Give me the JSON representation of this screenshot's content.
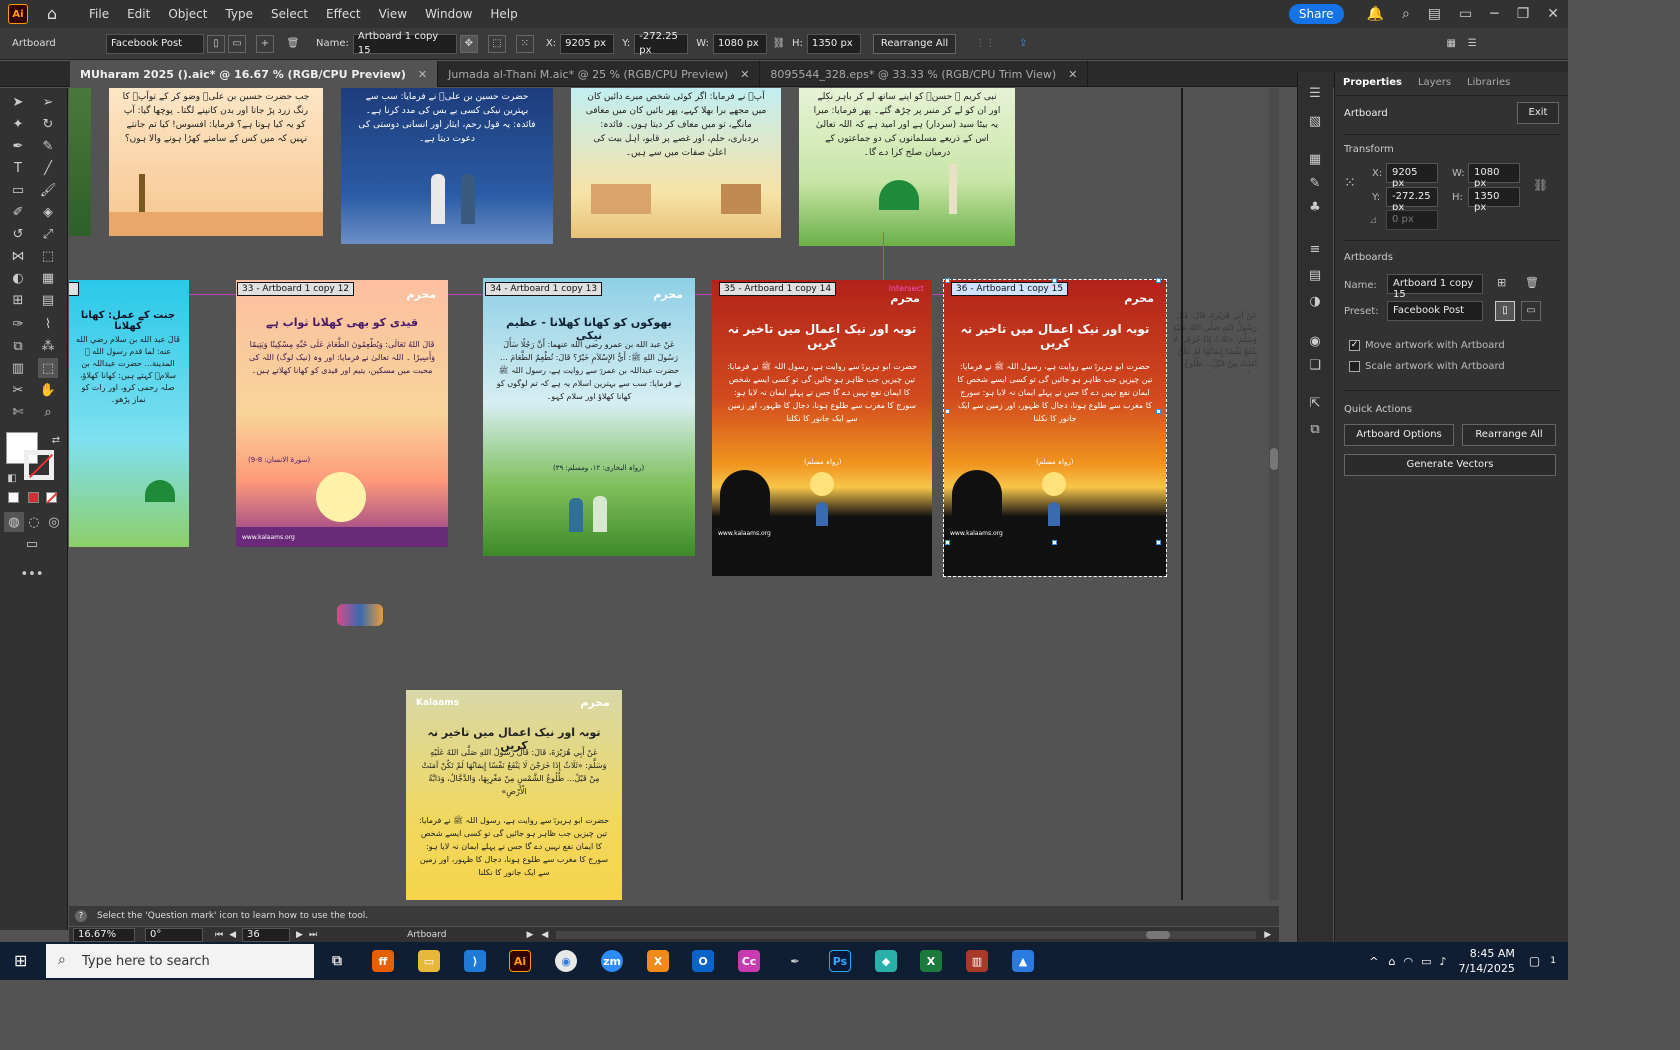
{
  "menubar": {
    "app_icon": "Ai",
    "items": [
      "File",
      "Edit",
      "Object",
      "Type",
      "Select",
      "Effect",
      "View",
      "Window",
      "Help"
    ],
    "share_label": "Share"
  },
  "controlbar": {
    "mode_label": "Artboard",
    "preset": "Facebook Post",
    "name_label": "Name:",
    "name_value": "Artboard 1 copy 15",
    "x_label": "X:",
    "x_value": "9205 px",
    "y_label": "Y:",
    "y_value": "-272.25 px",
    "w_label": "W:",
    "w_value": "1080 px",
    "h_label": "H:",
    "h_value": "1350 px",
    "rearrange_label": "Rearrange All"
  },
  "tabs": [
    {
      "label": "MUharam 2025 ().aic* @ 16.67 % (RGB/CPU Preview)",
      "active": true
    },
    {
      "label": "Jumada al-Thani M.aic* @ 25 % (RGB/CPU Preview)",
      "active": false
    },
    {
      "label": "8095544_328.eps* @ 33.33 % (RGB/CPU Trim View)",
      "active": false
    }
  ],
  "artboards": {
    "row1": [
      {
        "text": "جب حضرت حسین بن علیؓ وضو کر کے توآپؓ کا رنگ زرد پڑ جاتا اور بدن کانپنے لگتا۔ پوچھا گیا: آپ کو یہ کیا ہوتا ہے؟ فرمایا: افسوس! کیا تم جانتے نہیں کہ میں کس کے سامنے کھڑا ہونے والا ہوں؟"
      },
      {
        "text": "حضرت حسین بن علیؓ نے فرمایا: سب سے بہترین نیکی کسی بے بس کی مدد کرنا ہے۔ فائدہ: یہ قول رحم، ایثار اور انسانی دوستی کی دعوت دیتا ہے۔"
      },
      {
        "text": "آپؓ نے فرمایا: اگر کوئی شخص میرے دائیں کان میں مجھے برا بھلا کہے، پھر بائیں کان میں معافی مانگے، تو میں معاف کر دیتا ہوں۔ فائدہ: بردباری، حلم، اور غصے پر قابو، اہل بیت کی اعلیٰ صفات میں سے ہیں۔"
      },
      {
        "text": "نبی کریم ﷺ حسنؓ کو اپنے ساتھ لے کر باہر نکلے اور ان کو لے کر منبر پر چڑھ گئے۔ پھر فرمایا: میرا یہ بیٹا سید (سردار) ہے اور امید ہے کہ اللہ تعالیٰ اس کے ذریعے مسلمانوں کی دو جماعتوں کے درمیان صلح کرا دے گا۔"
      }
    ],
    "row2": [
      {
        "label": "",
        "title": "جنت کے عمل: کھانا کھلانا",
        "text": "قَالَ عبد الله بن سلام رضي الله عنه: لما قدم رسول الله ﷺ المدينة... حضرت عبداللہ بن سلامؓ کہتے ہیں: کھانا کھلاؤ، صلہ رحمی کرو، اور رات کو نماز پڑھو۔"
      },
      {
        "label": "33 - Artboard 1 copy 12",
        "title": "قیدی کو بھی کھلانا ثواب ہے",
        "text": "قَالَ اللهُ تَعَالَى: وَيُطْعِمُونَ الطَّعَامَ عَلَى حُبِّهِ مِسْكِينًا وَيَتِيمًا وَأَسِيرًا ۔ اللہ تعالیٰ نے فرمایا: اور وہ (نیک لوگ) اللہ کی محبت میں مسکین، یتیم اور قیدی کو کھانا کھلاتے ہیں۔",
        "ref": "(سورۃ الانسان: 8-9)"
      },
      {
        "label": "34 - Artboard 1 copy 13",
        "title": "بھوکوں کو کھانا کھلانا - عظیم نیکی",
        "text": "عَنْ عبد الله بن عمرو رضي الله عنهما: أَنَّ رَجُلًا سَأَلَ رَسُولَ اللهِ ﷺ: أَيُّ الإِسْلاَمِ خَيْرٌ؟ قَالَ: تُطْعِمُ الطَّعَامَ ... حضرت عبداللہ بن عمروؓ سے روایت ہے، رسول اللہ ﷺ نے فرمایا: سب سے بہترین اسلام یہ ہے کہ تم لوگوں کو کھانا کھلاؤ اور سلام کہو۔",
        "ref": "(رواہ البخاری: ۱۲، ومسلم: ۳۹)"
      },
      {
        "label": "35 - Artboard 1 copy 14",
        "title": "توبہ اور نیک اعمال میں تاخیر نہ کریں",
        "text": "حضرت ابو ہریرہؓ سے روایت ہے، رسول اللہ ﷺ نے فرمایا: تین چیزیں جب ظاہر ہو جائیں گی تو کسی ایسے شخص کا ایمان نفع نہیں دے گا جس نے پہلے ایمان نہ لایا ہو: سورج کا مغرب سے طلوع ہونا، دجال کا ظہور، اور زمین سے ایک جانور کا نکلنا",
        "ref": "(رواہ مسلم)",
        "badge": "intersect"
      },
      {
        "label": "36 - Artboard 1 copy 15",
        "title": "توبہ اور نیک اعمال میں تاخیر نہ کریں",
        "text": "حضرت ابو ہریرہؓ سے روایت ہے، رسول اللہ ﷺ نے فرمایا: تین چیزیں جب ظاہر ہو جائیں گی تو کسی ایسے شخص کا ایمان نفع نہیں دے گا جس نے پہلے ایمان نہ لایا ہو: سورج کا مغرب سے طلوع ہونا، دجال کا ظہور، اور زمین سے ایک جانور کا نکلنا",
        "ref": "(رواہ مسلم)"
      }
    ],
    "bottom": {
      "brand": "Kalaams",
      "logo": "محرم",
      "title": "توبہ اور نیک اعمال میں تاخیر نہ کریں",
      "arabic": "عَنْ أَبِي هُرَيْرَةَ، قَالَ: قَالَ رَسُولُ اللهِ صَلَّى اللهُ عَلَيْهِ وَسَلَّمَ: «ثَلَاثٌ إِذَا خَرَجْنَ لَا يَنْفَعُ نَفْسًا إِيمَانُهَا لَمْ تَكُنْ آمَنَتْ مِنْ قَبْلُ... طُلُوعُ الشَّمْسِ مِنْ مَغْرِبِهَا، وَالدَّجَّالُ، وَدَابَّةُ الْأَرْضِ»",
      "text": "حضرت ابو ہریرہؓ سے روایت ہے، رسول اللہ ﷺ نے فرمایا: تین چیزیں جب ظاہر ہو جائیں گی تو کسی ایسے شخص کا ایمان نفع نہیں دے گا جس نے پہلے ایمان نہ لایا ہو: سورج کا مغرب سے طلوع ہونا، دجال کا ظہور، اور زمین سے ایک جانور کا نکلنا"
    },
    "footer_url": "www.kalaams.org",
    "logo": "محرم"
  },
  "panel": {
    "tabs": [
      "Properties",
      "Layers",
      "Libraries"
    ],
    "artboard_label": "Artboard",
    "exit_label": "Exit",
    "transform_label": "Transform",
    "x_label": "X:",
    "x_value": "9205 px",
    "y_label": "Y:",
    "y_value": "-272.25 px",
    "w_label": "W:",
    "w_value": "1080 px",
    "h_label": "H:",
    "h_value": "1350 px",
    "angle_value": "0 px",
    "artboards_label": "Artboards",
    "name_label": "Name:",
    "name_value": "Artboard 1 copy 15",
    "preset_label": "Preset:",
    "preset_value": "Facebook Post",
    "move_artwork": "Move artwork with Artboard",
    "scale_artwork": "Scale artwork with Artboard",
    "quick_actions": "Quick Actions",
    "artboard_options": "Artboard Options",
    "rearrange_all": "Rearrange All",
    "generate_vectors": "Generate Vectors"
  },
  "hint": "Select the 'Question mark' icon to learn how to use the tool.",
  "bottombar": {
    "zoom": "16.67%",
    "angle": "0°",
    "page": "36",
    "mode": "Artboard"
  },
  "taskbar": {
    "search_placeholder": "Type here to search",
    "time": "8:45 AM",
    "date": "7/14/2025",
    "notif": "1"
  }
}
